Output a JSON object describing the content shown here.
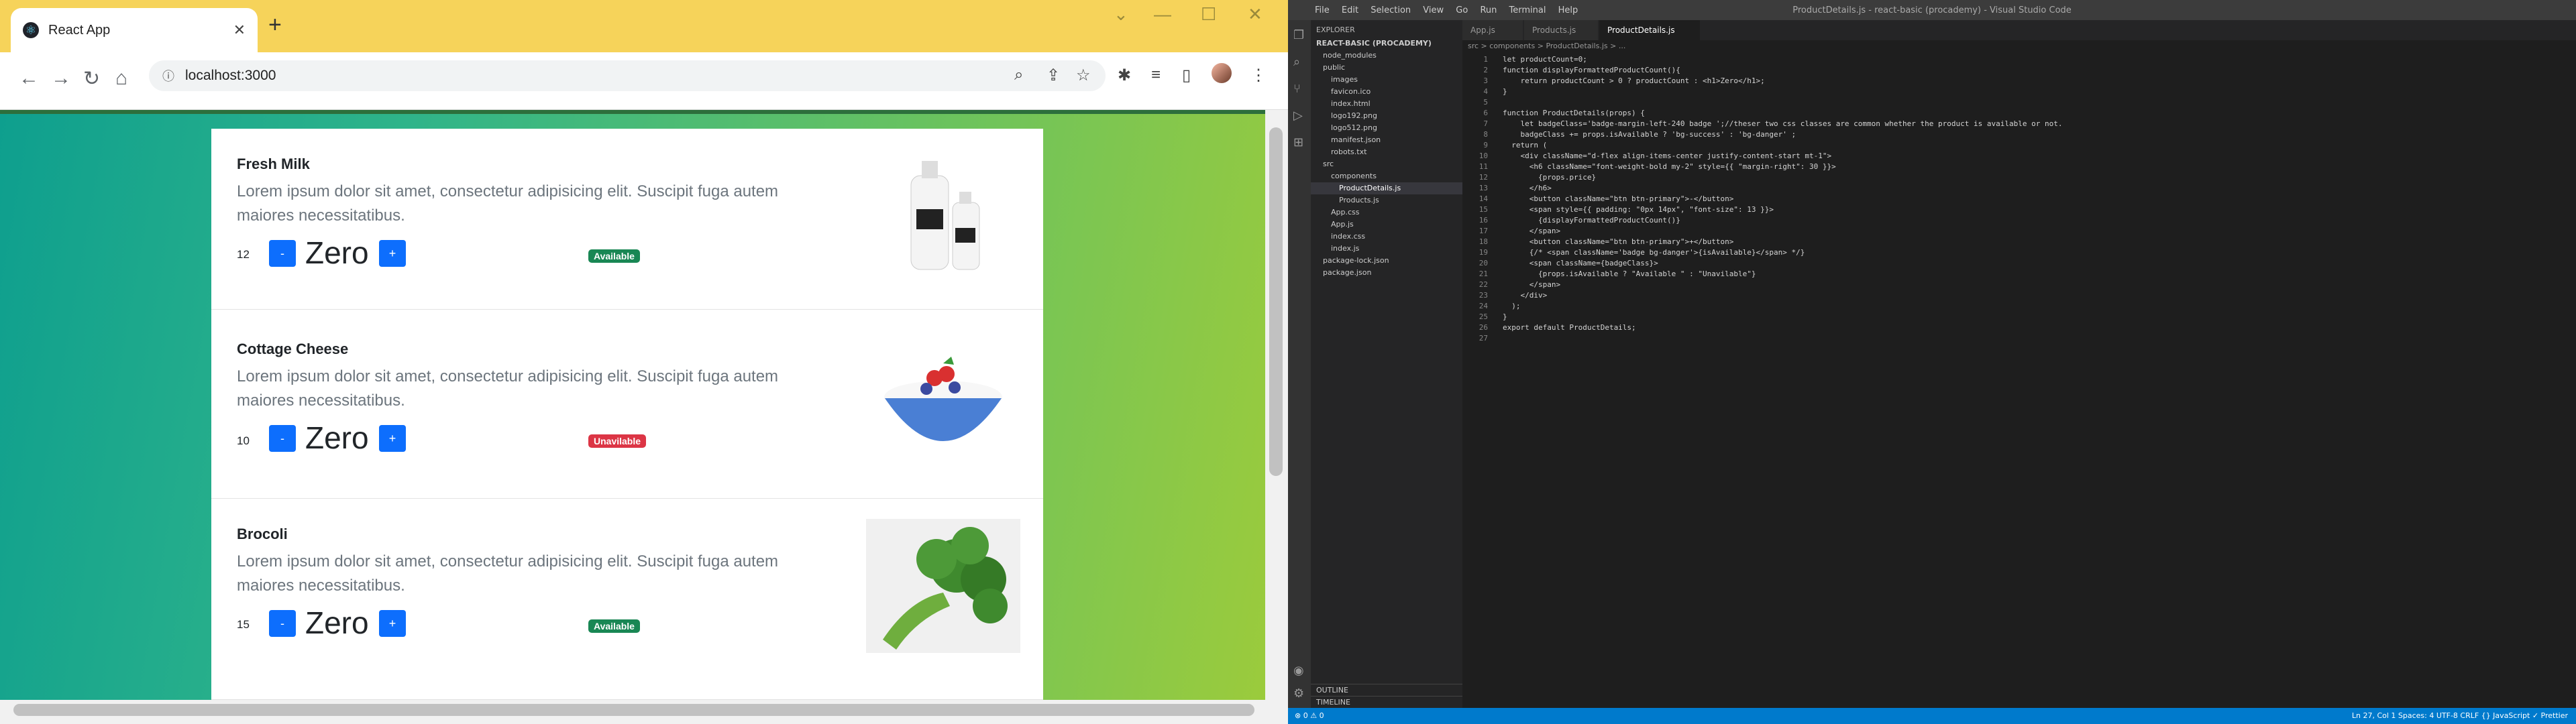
{
  "browser": {
    "tab_title": "React App",
    "url": "localhost:3000",
    "new_tab_icon": "plus-icon",
    "close_tab_icon": "close-icon"
  },
  "products": [
    {
      "name": "Fresh Milk",
      "description": "Lorem ipsum dolor sit amet, consectetur adipisicing elit. Suscipit fuga autem maiores necessitatibus.",
      "price": "12",
      "count_label": "Zero",
      "minus": "-",
      "plus": "+",
      "status": "Available",
      "status_color": "#198754",
      "image": "milk-bottles-image"
    },
    {
      "name": "Cottage Cheese",
      "description": "Lorem ipsum dolor sit amet, consectetur adipisicing elit. Suscipit fuga autem maiores necessitatibus.",
      "price": "10",
      "count_label": "Zero",
      "minus": "-",
      "plus": "+",
      "status": "Unavilable",
      "status_color": "#dc3545",
      "image": "cottage-cheese-bowl-image"
    },
    {
      "name": "Brocoli",
      "description": "Lorem ipsum dolor sit amet, consectetur adipisicing elit. Suscipit fuga autem maiores necessitatibus.",
      "price": "15",
      "count_label": "Zero",
      "minus": "-",
      "plus": "+",
      "status": "Available",
      "status_color": "#198754",
      "image": "broccoli-image"
    }
  ],
  "vscode": {
    "title": "ProductDetails.js - react-basic (procademy) - Visual Studio Code",
    "menu": [
      "File",
      "Edit",
      "Selection",
      "View",
      "Go",
      "Run",
      "Terminal",
      "Help"
    ],
    "explorer_title": "EXPLORER",
    "project": "REACT-BASIC (PROCADEMY)",
    "tree": [
      "node_modules",
      "public",
      "images",
      "favicon.ico",
      "index.html",
      "logo192.png",
      "logo512.png",
      "manifest.json",
      "robots.txt",
      "src",
      "components",
      "ProductDetails.js",
      "Products.js",
      "App.css",
      "App.js",
      "index.css",
      "index.js",
      "package-lock.json",
      "package.json"
    ],
    "outline": "OUTLINE",
    "timeline": "TIMELINE",
    "tabs": [
      "App.js",
      "Products.js",
      "ProductDetails.js"
    ],
    "breadcrumb": "src > components > ProductDetails.js > ...",
    "code": [
      "let productCount=0;",
      "function displayFormattedProductCount(){",
      "    return productCount > 0 ? productCount : <h1>Zero</h1>;",
      "}",
      "",
      "function ProductDetails(props) {",
      "    let badgeClass='badge-margin-left-240 badge ';//theser two css classes are common whether the product is available or not.",
      "    badgeClass += props.isAvailable ? 'bg-success' : 'bg-danger' ;",
      "  return (",
      "    <div className=\"d-flex align-items-center justify-content-start mt-1\">",
      "      <h6 className=\"font-weight-bold my-2\" style={{ \"margin-right\": 30 }}>",
      "        {props.price}",
      "      </h6>",
      "      <button className=\"btn btn-primary\">-</button>",
      "      <span style={{ padding: \"0px 14px\", \"font-size\": 13 }}>",
      "        {displayFormattedProductCount()}",
      "      </span>",
      "      <button className=\"btn btn-primary\">+</button>",
      "      {/* <span className='badge bg-danger'>{isAvailable}</span> */}",
      "      <span className={badgeClass}>",
      "        {props.isAvailable ? \"Available \" : \"Unavilable\"}",
      "      </span>",
      "    </div>",
      "  );",
      "}",
      "export default ProductDetails;",
      ""
    ],
    "status_left": "⊗ 0 ⚠ 0",
    "status_right": "Ln 27, Col 1   Spaces: 4   UTF-8   CRLF   {} JavaScript   ✓ Prettier"
  }
}
